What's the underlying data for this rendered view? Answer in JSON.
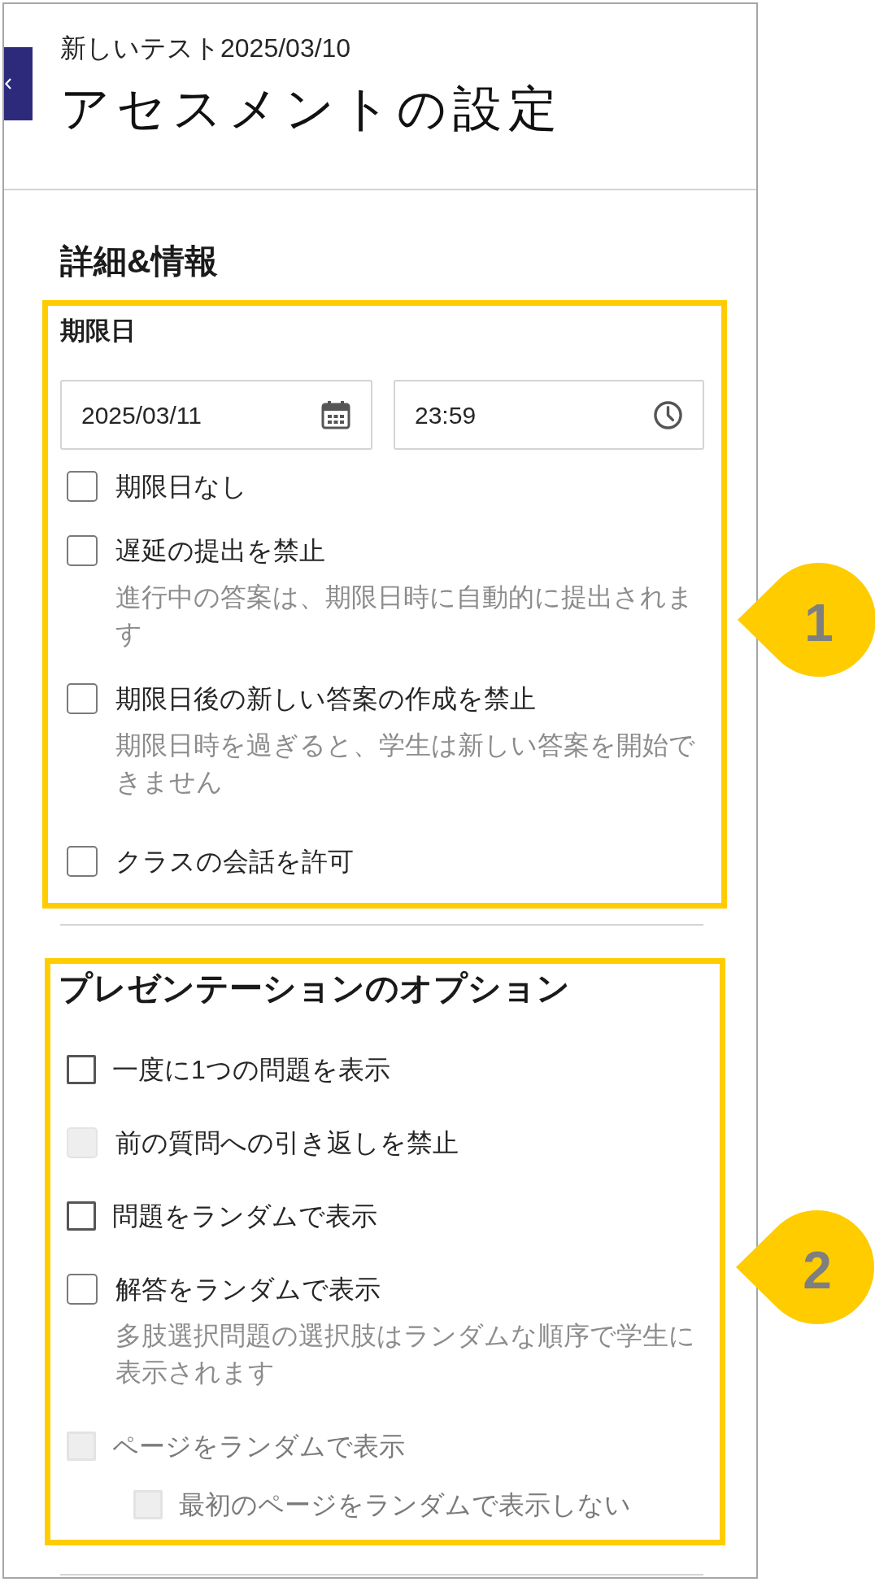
{
  "header": {
    "subtitle": "新しいテスト2025/03/10",
    "title": "アセスメントの設定"
  },
  "details_section": {
    "heading": "詳細&情報",
    "callout": {
      "label": "1"
    },
    "due_date": {
      "label": "期限日",
      "date": "2025/03/11",
      "time": "23:59",
      "options": [
        {
          "label": "期限日なし",
          "checked": false
        },
        {
          "label": "遅延の提出を禁止",
          "description": "進行中の答案は、期限日時に自動的に提出されます",
          "checked": false
        },
        {
          "label": "期限日後の新しい答案の作成を禁止",
          "description": "期限日時を過ぎると、学生は新しい答案を開始できません",
          "checked": false
        }
      ]
    },
    "options": [
      {
        "label": "クラスの会話を許可",
        "checked": false
      }
    ]
  },
  "presentation_section": {
    "heading": "プレゼンテーションのオプション",
    "callout": {
      "label": "2"
    },
    "options": [
      {
        "kind": "square",
        "label": "一度に1つの問題を表示",
        "checked": false,
        "disabled": false,
        "greyed": false
      },
      {
        "kind": "rounded",
        "label": "前の質問への引き返しを禁止",
        "checked": false,
        "disabled": true,
        "greyed": false
      },
      {
        "kind": "square",
        "label": "問題をランダムで表示",
        "checked": false,
        "disabled": false,
        "greyed": false
      },
      {
        "kind": "rounded",
        "label": "解答をランダムで表示",
        "description": "多肢選択問題の選択肢はランダムな順序で学生に表示されます",
        "checked": false,
        "disabled": false,
        "greyed": false
      },
      {
        "kind": "square",
        "label": "ページをランダムで表示",
        "checked": false,
        "disabled": true,
        "greyed": true,
        "children": [
          {
            "kind": "square",
            "label": "最初のページをランダムで表示しない",
            "checked": false,
            "disabled": true,
            "greyed": true
          }
        ]
      }
    ]
  }
}
